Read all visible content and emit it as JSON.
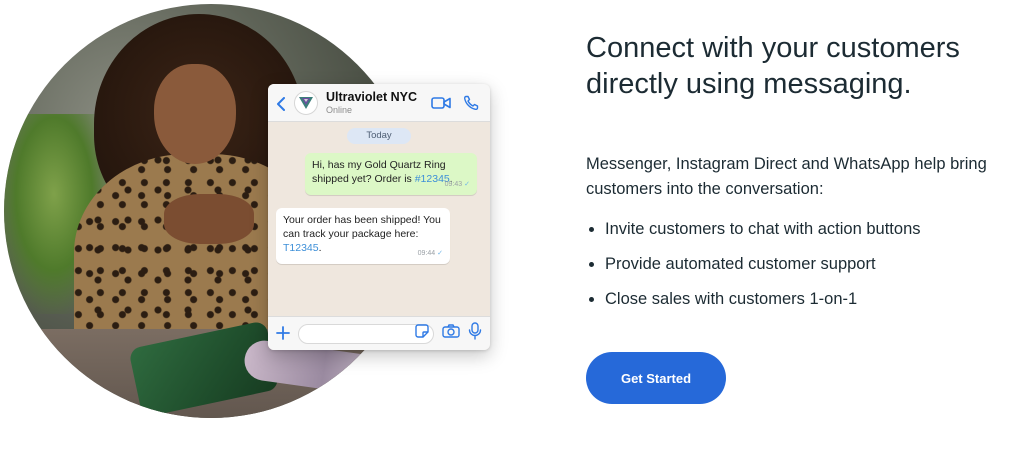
{
  "hero": {
    "headline": "Connect with your customers directly using messaging.",
    "description": "Messenger, Instagram Direct and WhatsApp help bring customers into the conversation:",
    "bullets": [
      "Invite customers to chat with action buttons",
      "Provide automated customer support",
      "Close sales with customers 1-on-1"
    ],
    "cta_label": "Get Started",
    "cta_color": "#2669d9"
  },
  "chat": {
    "contact_name": "Ultraviolet NYC",
    "contact_status": "Online",
    "day_label": "Today",
    "messages": [
      {
        "direction": "outgoing",
        "text_before_link": "Hi, has my Gold Quartz Ring shipped yet? Order is ",
        "link": "#12345",
        "text_after_link": ".",
        "time": "09:43"
      },
      {
        "direction": "incoming",
        "text_before_link": "Your order has been shipped! You can track your package here: ",
        "link": "T12345",
        "text_after_link": ".",
        "time": "09:44"
      }
    ],
    "icons": {
      "back": "chevron-left-icon",
      "video": "video-camera-icon",
      "call": "phone-icon",
      "attach": "plus-icon",
      "sticker": "sticker-icon",
      "camera": "camera-icon",
      "mic": "microphone-icon"
    },
    "accent_color": "#2f7ae5",
    "outgoing_bubble_color": "#dcf8c6"
  }
}
